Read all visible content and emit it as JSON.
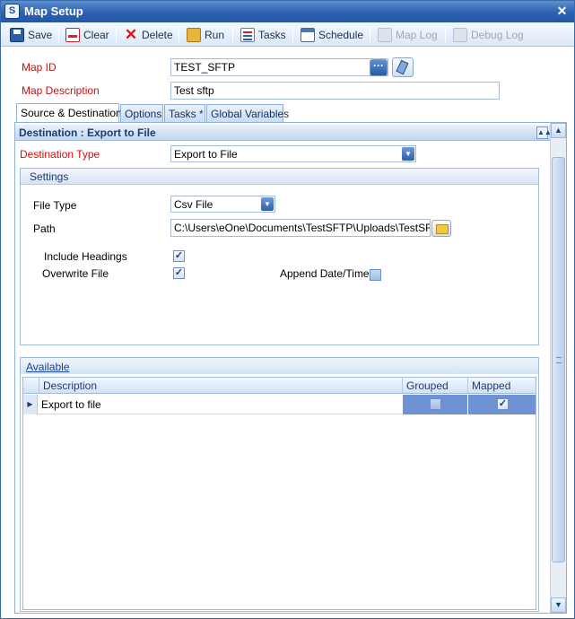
{
  "window": {
    "title": "Map Setup",
    "close_glyph": "✕",
    "app_icon": "S"
  },
  "toolbar": {
    "save": "Save",
    "clear": "Clear",
    "delete": "Delete",
    "run": "Run",
    "tasks": "Tasks",
    "schedule": "Schedule",
    "map_log": "Map Log",
    "debug_log": "Debug Log"
  },
  "form": {
    "map_id_label": "Map ID",
    "map_id_value": "TEST_SFTP",
    "map_description_label": "Map Description",
    "map_description_value": "Test sftp"
  },
  "tabs": [
    {
      "label": "Source & Destination"
    },
    {
      "label": "Options"
    },
    {
      "label": "Tasks *"
    },
    {
      "label": "Global Variables"
    }
  ],
  "destination": {
    "header": "Destination : Export to File",
    "type_label": "Destination Type",
    "type_value": "Export to File"
  },
  "settings": {
    "header": "Settings",
    "file_type_label": "File Type",
    "file_type_value": "Csv File",
    "path_label": "Path",
    "path_value": "C:\\Users\\eOne\\Documents\\TestSFTP\\Uploads\\TestSFTP.csv",
    "include_headings_label": "Include Headings",
    "include_headings": true,
    "overwrite_file_label": "Overwrite File",
    "overwrite_file": true,
    "append_datetime_label": "Append Date/Time",
    "append_datetime": false
  },
  "available": {
    "header": "Available",
    "columns": [
      "Description",
      "Grouped",
      "Mapped"
    ],
    "rows": [
      {
        "description": "Export to file",
        "grouped": false,
        "mapped": true
      }
    ]
  },
  "glyphs": {
    "check": "✓",
    "row_pointer": "▶",
    "combo_arrow": "▼",
    "collapse": "▲▲",
    "scroll_up": "▲",
    "scroll_down": "▼",
    "dots": "···",
    "delete_x": "✕"
  },
  "colors": {
    "title_bar": "#2d62b0",
    "required_label": "#d01010",
    "selection": "#6f93d2"
  }
}
